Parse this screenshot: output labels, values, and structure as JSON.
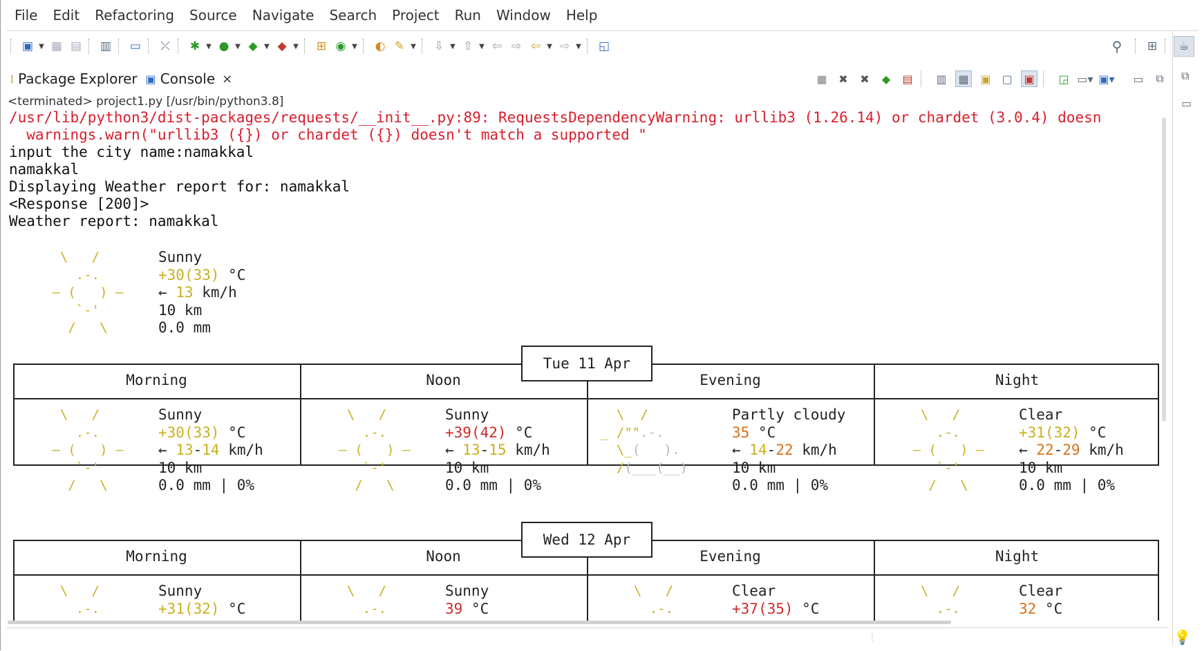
{
  "menu": [
    "File",
    "Edit",
    "Refactoring",
    "Source",
    "Navigate",
    "Search",
    "Project",
    "Run",
    "Window",
    "Help"
  ],
  "tabs": [
    {
      "label": "Package Explorer",
      "icon": "package-explorer-icon"
    },
    {
      "label": "Console",
      "icon": "console-icon",
      "close": "×"
    }
  ],
  "console": {
    "status": "<terminated> project1.py [/usr/bin/python3.8]",
    "warning_line1": "/usr/lib/python3/dist-packages/requests/__init__.py:89: RequestsDependencyWarning: urllib3 (1.26.14) or chardet (3.0.4) doesn",
    "warning_line2": "  warnings.warn(\"urllib3 ({}) or chardet ({}) doesn't match a supported \"",
    "input_prompt": "input the city name:namakkal",
    "echo": "namakkal",
    "displaying": "Displaying Weather report for: namakkal",
    "response": "<Response [200]>",
    "report_title": "Weather report: namakkal"
  },
  "current": {
    "condition": "Sunny",
    "temp_a": "+30",
    "temp_b": "(33)",
    "temp_unit": " °C",
    "wind_arrow": "← ",
    "wind": "13",
    "wind_unit": " km/h",
    "visibility": "10 km",
    "precip": "0.0 mm"
  },
  "days": [
    {
      "date": "Tue 11 Apr",
      "periods": [
        {
          "name": "Morning",
          "condition": "Sunny",
          "temp_a": "+30",
          "temp_b": "(33)",
          "temp_unit": " °C",
          "wind_a": "13",
          "wind_sep": "-",
          "wind_b": "14",
          "wind_unit": " km/h",
          "visibility": "10 km",
          "precip": "0.0 mm | 0%",
          "art": "sun"
        },
        {
          "name": "Noon",
          "condition": "Sunny",
          "temp_a": "+39",
          "temp_b": "(42)",
          "temp_unit": " °C",
          "wind_a": "13",
          "wind_sep": "-",
          "wind_b": "15",
          "wind_unit": " km/h",
          "visibility": "10 km",
          "precip": "0.0 mm | 0%",
          "art": "sun"
        },
        {
          "name": "Evening",
          "condition": "Partly cloudy",
          "temp_a": "35",
          "temp_b": "",
          "temp_unit": " °C",
          "wind_a": "14",
          "wind_sep": "-",
          "wind_b": "22",
          "wind_unit": " km/h",
          "visibility": "10 km",
          "precip": "0.0 mm | 0%",
          "art": "cloud"
        },
        {
          "name": "Night",
          "condition": "Clear",
          "temp_a": "+31",
          "temp_b": "(32)",
          "temp_unit": " °C",
          "wind_a": "22",
          "wind_sep": "-",
          "wind_b": "29",
          "wind_unit": " km/h",
          "visibility": "10 km",
          "precip": "0.0 mm | 0%",
          "art": "sun"
        }
      ]
    },
    {
      "date": "Wed 12 Apr",
      "periods": [
        {
          "name": "Morning",
          "condition": "Sunny",
          "temp_a": "+31",
          "temp_b": "(32)",
          "temp_unit": " °C",
          "art": "sun"
        },
        {
          "name": "Noon",
          "condition": "Sunny",
          "temp_a": "39",
          "temp_b": "",
          "temp_unit": " °C",
          "art": "sun"
        },
        {
          "name": "Evening",
          "condition": "Clear",
          "temp_a": "+37",
          "temp_b": "(35)",
          "temp_unit": " °C",
          "art": "sun"
        },
        {
          "name": "Night",
          "condition": "Clear",
          "temp_a": "32",
          "temp_b": "",
          "temp_unit": " °C",
          "art": "sun"
        }
      ]
    }
  ],
  "colors": {
    "warning": "#d81e2c",
    "sun": "#c8b020",
    "warm": "#d6701a",
    "hot": "#cf2a2a"
  }
}
